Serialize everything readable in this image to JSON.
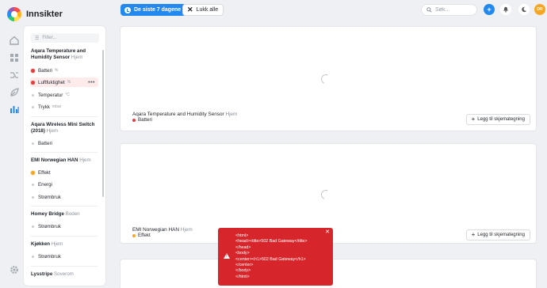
{
  "app": {
    "title": "Innsikter"
  },
  "toolbar": {
    "range_label": "De siste 7 dagene",
    "close_all_label": "Lukk alle",
    "search_placeholder": "Søk...",
    "avatar_initials": "DR"
  },
  "rail": [
    "home-icon",
    "dashboard-icon",
    "flows-icon",
    "energy-icon",
    "insights-icon",
    "settings-icon"
  ],
  "sidebar": {
    "filter_placeholder": "Filter...",
    "devices": [
      {
        "name": "Aqara Temperature and Humidity Sensor",
        "zone": "Hjem",
        "items": [
          {
            "label": "Batteri",
            "unit": "%",
            "state": "red"
          },
          {
            "label": "Luftfuktighet",
            "unit": "%",
            "state": "red",
            "active": true
          },
          {
            "label": "Temperatur",
            "unit": "°C",
            "state": "off"
          },
          {
            "label": "Trykk",
            "unit": "mbar",
            "state": "off"
          }
        ]
      },
      {
        "name": "Aqara Wireless Mini Switch (2018)",
        "zone": "Hjem",
        "items": [
          {
            "label": "Batteri",
            "unit": "",
            "state": "off"
          }
        ]
      },
      {
        "name": "EMI Norwegian HAN",
        "zone": "Hjem",
        "items": [
          {
            "label": "Effekt",
            "unit": "",
            "state": "orange"
          },
          {
            "label": "Energi",
            "unit": "",
            "state": "off"
          },
          {
            "label": "Strømbruk",
            "unit": "",
            "state": "off"
          }
        ]
      },
      {
        "name": "Homey Bridge",
        "zone": "Boden",
        "items": [
          {
            "label": "Strømbruk",
            "unit": "",
            "state": "off"
          }
        ]
      },
      {
        "name": "Kjøkken",
        "zone": "Hjem",
        "items": [
          {
            "label": "Strømbruk",
            "unit": "",
            "state": "off"
          }
        ]
      },
      {
        "name": "Lysstripe",
        "zone": "Soverom",
        "items": []
      }
    ]
  },
  "cards": [
    {
      "device": "Aqara Temperature and Humidity Sensor",
      "zone": "Hjem",
      "metric": "Batteri",
      "color": "#e23c3c",
      "add_label": "Legg til skjemategning"
    },
    {
      "device": "EMI Norwegian HAN",
      "zone": "Hjem",
      "metric": "Effekt",
      "color": "#f5a623",
      "add_label": "Legg til skjemategning"
    }
  ],
  "error_toast": {
    "message": "<html>\n<head><title>502 Bad Gateway</title>\n</head>\n<body>\n<center><h1>502 Bad Gateway</h1>\n</center>\n</body>\n</html>"
  },
  "colors": {
    "accent": "#2389ee",
    "error": "#d7262b",
    "warning": "#f5a623"
  }
}
